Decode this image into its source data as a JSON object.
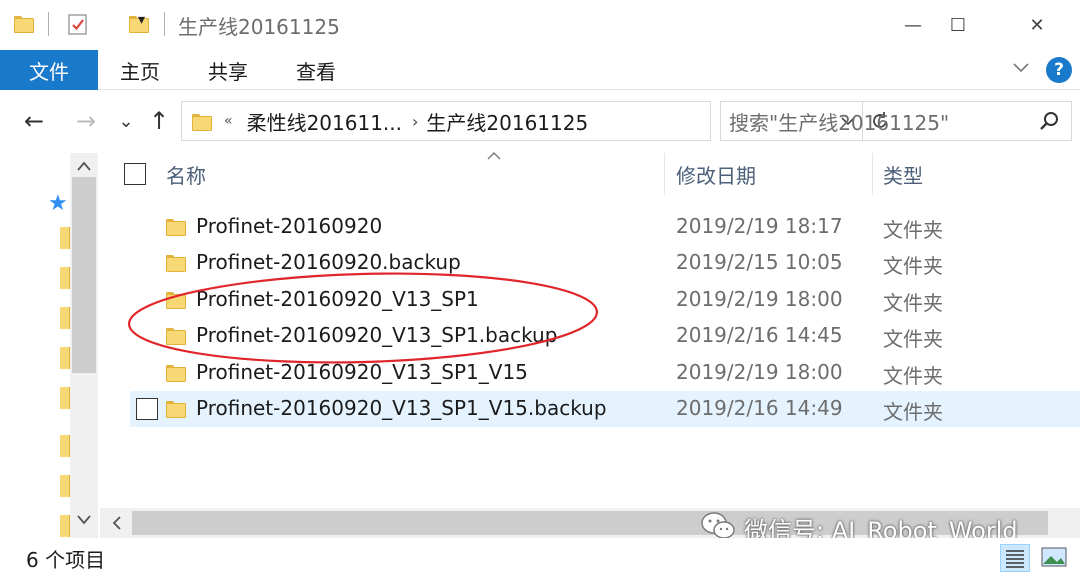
{
  "window": {
    "title": "生产线20161125",
    "controls": {
      "minimize": "—",
      "maximize": "☐",
      "close": "✕"
    }
  },
  "ribbon": {
    "file_tab": "文件",
    "tabs": [
      "主页",
      "共享",
      "查看"
    ],
    "help": "?",
    "accent_color": "#1979ca"
  },
  "nav": {
    "back": "←",
    "forward": "→",
    "recent": "⌄",
    "up": "↑",
    "breadcrumb": [
      {
        "label": "«"
      },
      {
        "label": "柔性线201611..."
      },
      {
        "label": "生产线20161125"
      }
    ],
    "breadcrumb_separator": "›",
    "search_placeholder": "搜索\"生产线20161125\""
  },
  "list": {
    "columns": {
      "name": "名称",
      "date": "修改日期",
      "type": "类型"
    },
    "rows": [
      {
        "name": "Profinet-20160920",
        "date": "2019/2/19 18:17",
        "type": "文件夹"
      },
      {
        "name": "Profinet-20160920.backup",
        "date": "2019/2/15 10:05",
        "type": "文件夹"
      },
      {
        "name": "Profinet-20160920_V13_SP1",
        "date": "2019/2/19 18:00",
        "type": "文件夹"
      },
      {
        "name": "Profinet-20160920_V13_SP1.backup",
        "date": "2019/2/16 14:45",
        "type": "文件夹"
      },
      {
        "name": "Profinet-20160920_V13_SP1_V15",
        "date": "2019/2/19 18:00",
        "type": "文件夹"
      },
      {
        "name": "Profinet-20160920_V13_SP1_V15.backup",
        "date": "2019/2/16 14:49",
        "type": "文件夹"
      }
    ],
    "hover_row_index": 5,
    "annotation_color": "#e0262b"
  },
  "status": {
    "item_count": "6 个项目"
  },
  "watermark": {
    "text": "微信号: AI_Robot_World"
  }
}
